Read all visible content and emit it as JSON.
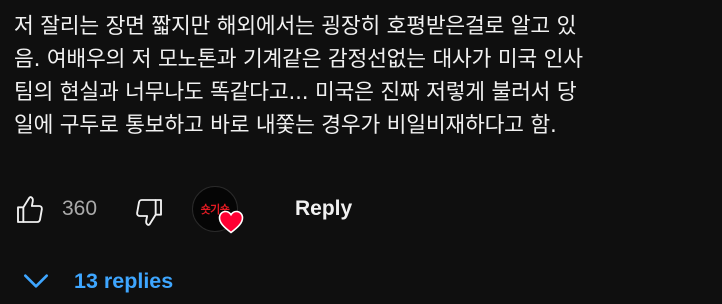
{
  "comment": {
    "lines": [
      "저 잘리는 장면 짧지만 해외에서는 굉장히 호평받은걸로 알고 있",
      "음. 여배우의 저 모노톤과 기계같은 감정선없는 대사가 미국 인사",
      "팀의 현실과 너무나도 똑같다고... 미국은 진짜 저렇게 불러서 당",
      "일에 구두로 통보하고 바로 내쫓는 경우가 비일비재하다고 함."
    ]
  },
  "actions": {
    "like_icon": "thumbs-up-icon",
    "like_count": "360",
    "dislike_icon": "thumbs-down-icon",
    "creator_avatar_text": "숏기숏",
    "heart_icon": "heart-icon",
    "heart_color": "#ff0033",
    "reply_label": "Reply"
  },
  "replies": {
    "chevron_icon": "chevron-down-icon",
    "label": "13 replies",
    "color": "#3ea6ff"
  }
}
